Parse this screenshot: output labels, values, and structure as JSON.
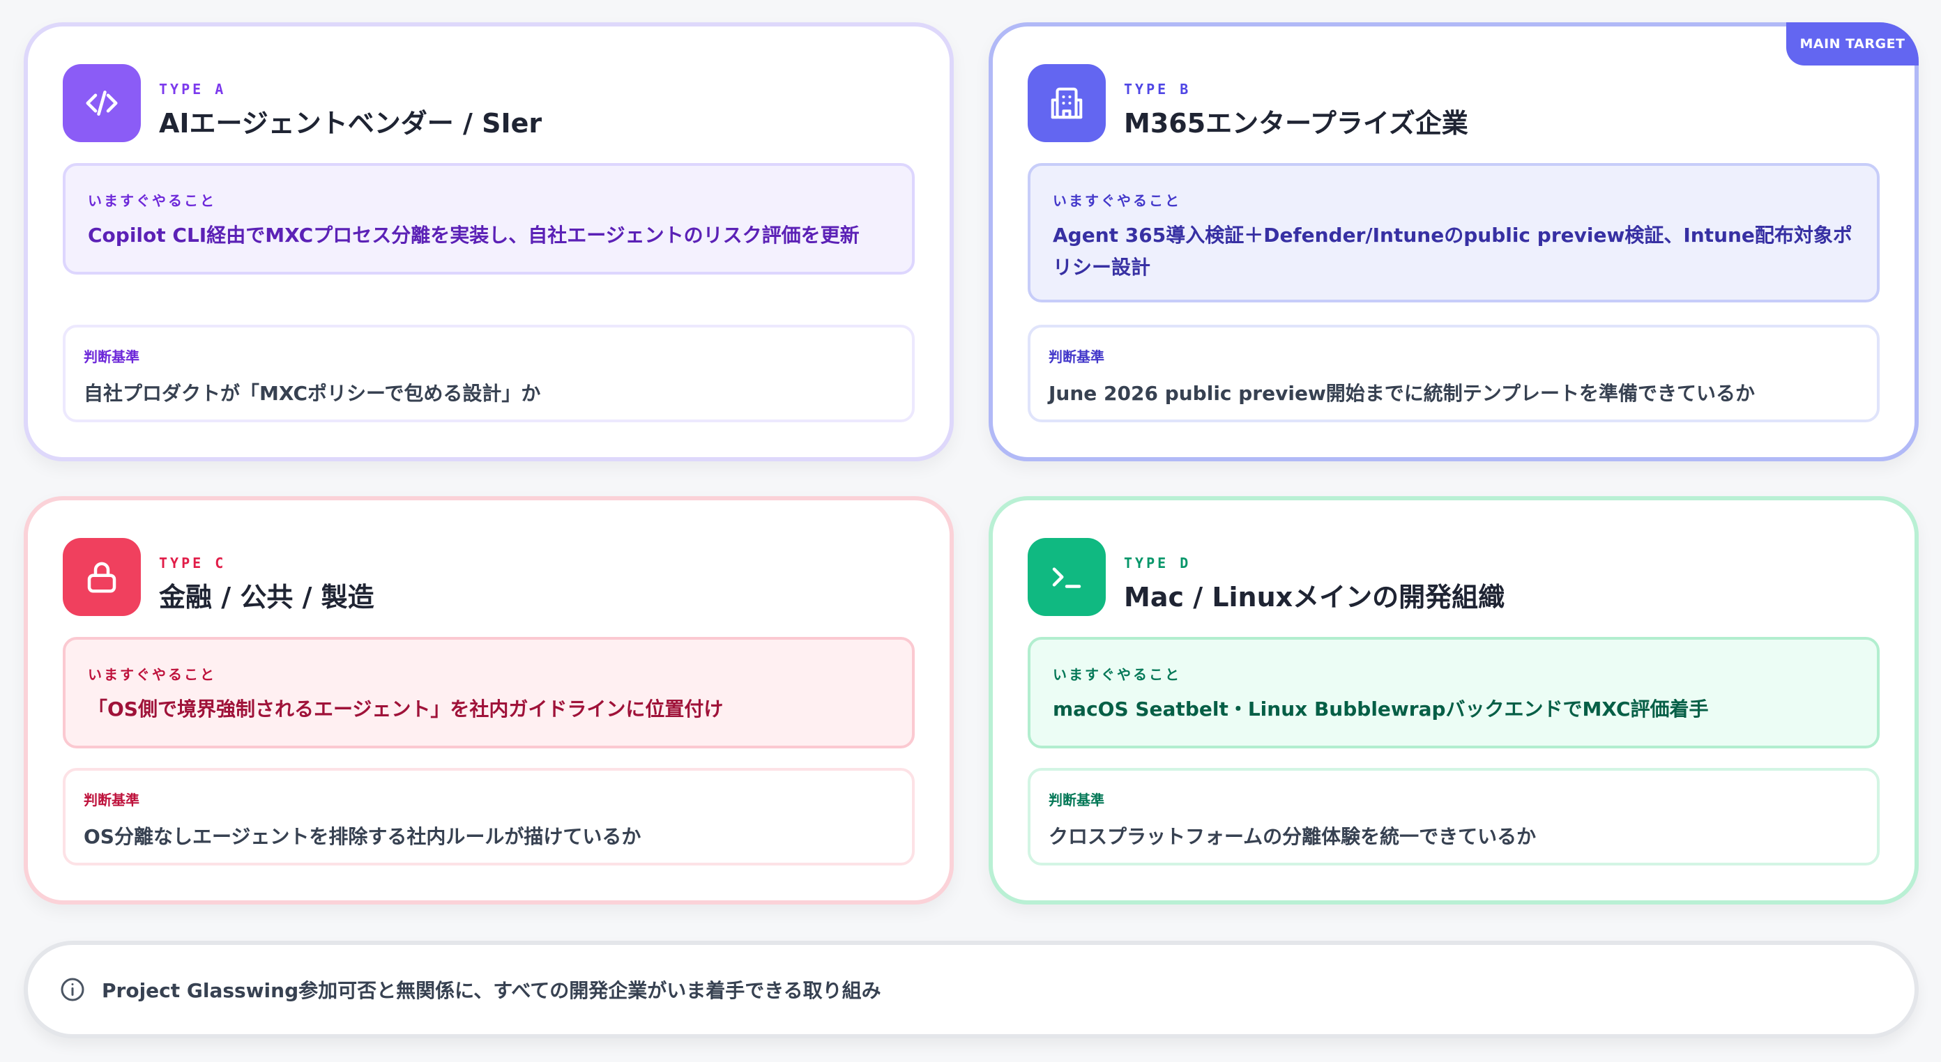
{
  "cards": [
    {
      "type_label": "TYPE A",
      "title": "AIエージェントベンダー / SIer",
      "icon": "code-icon",
      "action_label": "いますぐやること",
      "action_text": "Copilot CLI経由でMXCプロセス分離を実装し、自社エージェントのリスク評価を更新",
      "criteria_label": "判断基準",
      "criteria_text": "自社プロダクトが「MXCポリシーで包める設計」か",
      "accent": "#8b5cf6"
    },
    {
      "type_label": "TYPE B",
      "title": "M365エンタープライズ企業",
      "icon": "building-icon",
      "badge": "MAIN TARGET",
      "action_label": "いますぐやること",
      "action_text": "Agent 365導入検証＋Defender/Intuneのpublic preview検証、Intune配布対象ポリシー設計",
      "criteria_label": "判断基準",
      "criteria_text": "June 2026 public preview開始までに統制テンプレートを準備できているか",
      "accent": "#6366f1"
    },
    {
      "type_label": "TYPE C",
      "title": "金融 / 公共 / 製造",
      "icon": "lock-icon",
      "action_label": "いますぐやること",
      "action_text": "「OS側で境界強制されるエージェント」を社内ガイドラインに位置付け",
      "criteria_label": "判断基準",
      "criteria_text": "OS分離なしエージェントを排除する社内ルールが描けているか",
      "accent": "#f0405e"
    },
    {
      "type_label": "TYPE D",
      "title": "Mac / Linuxメインの開発組織",
      "icon": "terminal-icon",
      "action_label": "いますぐやること",
      "action_text": "macOS Seatbelt・Linux BubblewrapバックエンドでMXC評価着手",
      "criteria_label": "判断基準",
      "criteria_text": "クロスプラットフォームの分離体験を統一できているか",
      "accent": "#10b981"
    }
  ],
  "footer": {
    "icon": "info-icon",
    "text": "Project Glasswing参加可否と無関係に、すべての開発企業がいま着手できる取り組み"
  }
}
